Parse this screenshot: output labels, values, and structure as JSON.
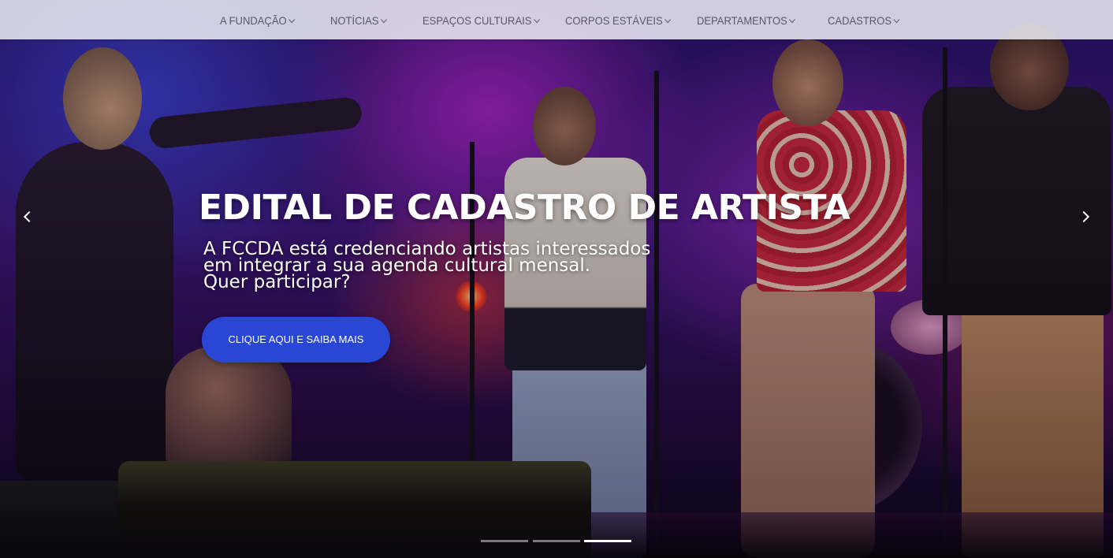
{
  "nav": {
    "items": [
      {
        "label": "A FUNDAÇÃO"
      },
      {
        "label": "NOTÍCIAS"
      },
      {
        "label": "ESPAÇOS CULTURAIS"
      },
      {
        "label": "CORPOS ESTÁVEIS"
      },
      {
        "label": "DEPARTAMENTOS"
      },
      {
        "label": "CADASTROS"
      }
    ]
  },
  "slide": {
    "title": "EDITAL DE CADASTRO DE ARTISTA",
    "lines": [
      "A FCCDA está credenciando artistas interessados",
      "em integrar a sua agenda cultural mensal.",
      "Quer participar?"
    ],
    "cta_label": "CLIQUE AQUI E SAIBA MAIS"
  },
  "carousel": {
    "slide_count": 3,
    "active_index": 2,
    "prev_icon": "chevron-left-icon",
    "next_icon": "chevron-right-icon"
  },
  "colors": {
    "cta": "#2a46d4",
    "nav_background": "#ececf6",
    "nav_text": "#575766"
  }
}
